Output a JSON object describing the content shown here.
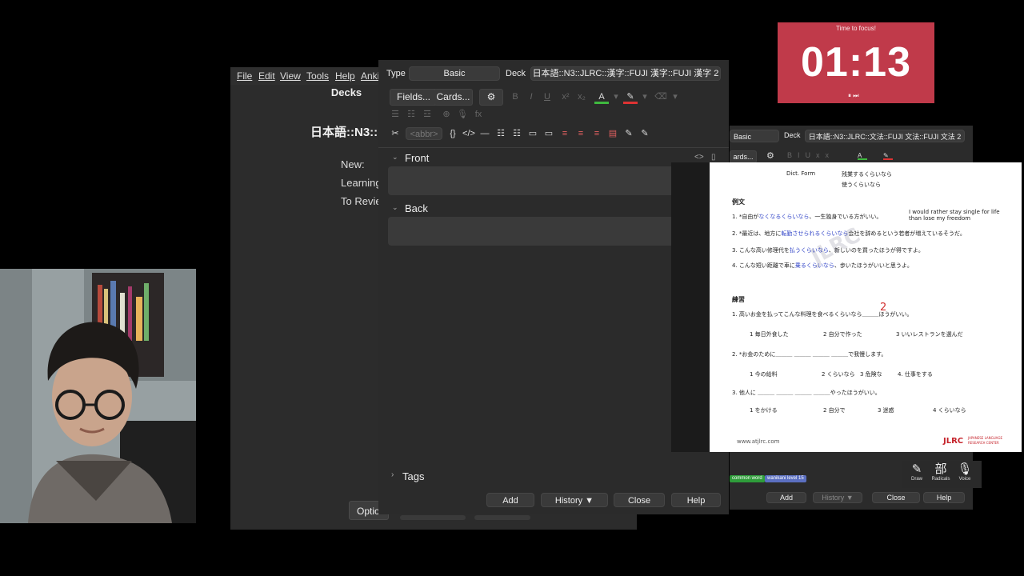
{
  "anki_main": {
    "menu": [
      "File",
      "Edit",
      "View",
      "Tools",
      "Help",
      "Anki"
    ],
    "title": "Decks",
    "deck_name": "日本語::N3::",
    "stats": [
      "New:",
      "Learning",
      "To Revie"
    ],
    "options_label": "Optio"
  },
  "add_window": {
    "type_label": "Type",
    "type_value": "Basic",
    "deck_label": "Deck",
    "deck_value": "日本語::N3::JLRC::漢字::FUJI 漢字::FUJI 漢字 2",
    "fields_button": "Fields...",
    "cards_button": "Cards...",
    "format_tools": [
      "B",
      "I",
      "U",
      "x²",
      "x₂",
      "A",
      "▾",
      "✎",
      "▾",
      "⌫",
      "▾"
    ],
    "format_tools_row2": [
      "☰",
      "☷",
      "☲",
      "⊕",
      "🎙",
      "fx"
    ],
    "format_tools_row3": [
      "✂",
      "<abbr>",
      "{}",
      "</>",
      "—",
      "☷",
      "☷",
      "▭",
      "▭",
      "≡",
      "≡",
      "≡",
      "▤",
      "✎",
      "✎"
    ],
    "front_label": "Front",
    "back_label": "Back",
    "tags_label": "Tags",
    "buttons": {
      "add": "Add",
      "history": "History ▼",
      "close": "Close",
      "help": "Help"
    }
  },
  "add_window_2": {
    "type_value": "Basic",
    "deck_label": "Deck",
    "deck_value": "日本語::N3::JLRC::文法::FUJI 文法::FUJI 文法 2",
    "cards_button": "ards...",
    "tags": [
      {
        "label": "common word",
        "color": "#2e9c3a"
      },
      {
        "label": "wanikani level 15",
        "color": "#5b6fc0"
      }
    ],
    "buttons": {
      "add": "Add",
      "history": "History ▼",
      "close": "Close",
      "help": "Help"
    }
  },
  "timer": {
    "heading": "Time to focus!",
    "time": "01:13",
    "controls": "⏸ ⏭"
  },
  "palette": {
    "items": [
      {
        "icon": "✎",
        "label": "Draw"
      },
      {
        "icon": "部",
        "label": "Radicals"
      },
      {
        "icon": "🎙",
        "label": "Voice"
      }
    ]
  },
  "worksheet": {
    "form_label": "Dict. Form",
    "form_ex1": "残業するくらいなら",
    "form_ex2": "使うくらいなら",
    "examples_heading": "例文",
    "examples": [
      {
        "pre": "1. *自由が",
        "hl": "なくなるくらいなら",
        "post": "、一生独身でいる方がいい。"
      },
      {
        "pre": "2. *最近は、地方に",
        "hl": "転勤させられるくらいなら",
        "post": "会社を辞めるという若者が増えているそうだ。"
      },
      {
        "pre": "3. こんな高い修理代を",
        "hl": "払うくらいなら",
        "post": "、新しいのを買ったほうが得ですよ。"
      },
      {
        "pre": "4. こんな短い距離で車に",
        "hl": "乗るくらいなら",
        "post": "、歩いたほうがいいと思うよ。"
      }
    ],
    "translation_1": "I would rather stay single for life",
    "translation_2": "than lose my freedom",
    "practice_heading": "練習",
    "q1": "1. 高いお金を払ってこんな料理を食べるくらいなら＿＿＿ほうがいい。",
    "q1_answer": "2",
    "q1_options": [
      "1 毎日外食した",
      "2 自分で作った",
      "3 いいレストランを選んだ"
    ],
    "q2": "2. *お金のために＿＿＿ ＿＿＿ ＿＿＿ ＿＿＿で我慢します。",
    "q2_options": [
      "1 今の給料",
      "2 くらいなら",
      "3 危険な",
      "4. 仕事をする"
    ],
    "q3": "3. 他人に ＿＿＿ ＿＿＿ ＿＿＿ ＿＿＿やったほうがいい。",
    "q3_options": [
      "1 をかける",
      "2 自分で",
      "3 迷惑",
      "4 くらいなら"
    ],
    "watermark": "JLRC",
    "footer_url": "www.atjlrc.com",
    "footer_brand": "JLRC",
    "footer_brand_sub1": "JAPANESE LANGUAGE",
    "footer_brand_sub2": "RESEARCH CENTER"
  }
}
